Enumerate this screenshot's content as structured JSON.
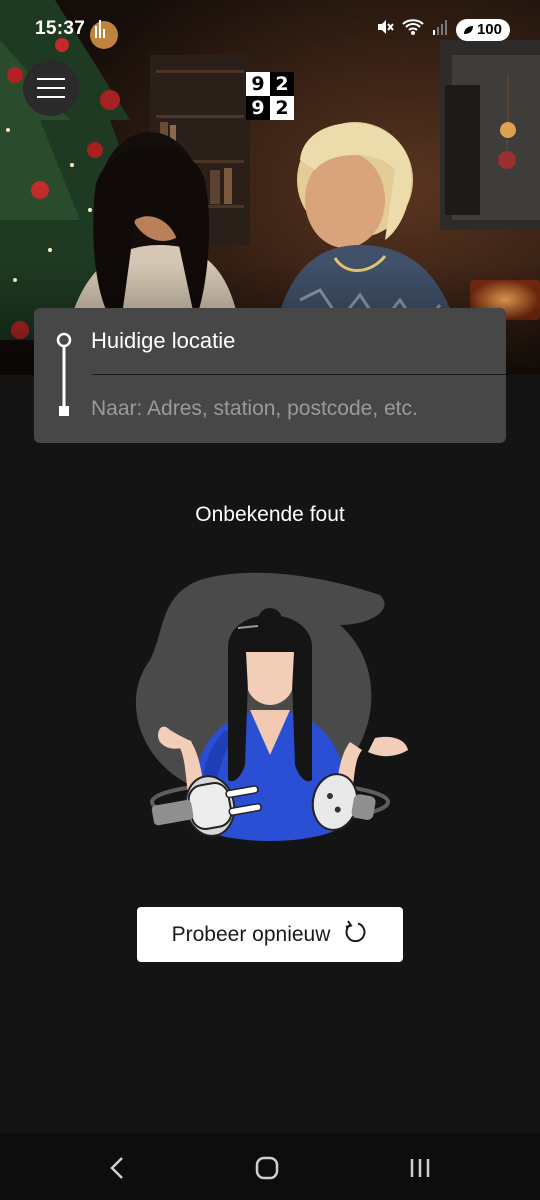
{
  "status_bar": {
    "time": "15:37",
    "battery": "100",
    "icons": [
      "signal-activity-icon",
      "mute-icon",
      "wifi-icon",
      "cell-signal-icon",
      "battery-icon"
    ]
  },
  "header": {
    "menu_icon": "hamburger-menu-icon",
    "logo_digits": [
      "9",
      "2",
      "9",
      "2"
    ]
  },
  "route": {
    "from_value": "Huidige locatie",
    "to_placeholder": "Naar: Adres, station, postcode, etc."
  },
  "error": {
    "title": "Onbekende fout",
    "illustration": "unplugged-cable-illustration"
  },
  "retry": {
    "label": "Probeer opnieuw",
    "icon": "refresh-icon"
  },
  "navigation": {
    "back_icon": "back-icon",
    "home_icon": "home-icon",
    "recents_icon": "recents-icon"
  },
  "colors": {
    "background": "#141414",
    "card": "#474747",
    "accent_blue": "#1f4fd0"
  }
}
